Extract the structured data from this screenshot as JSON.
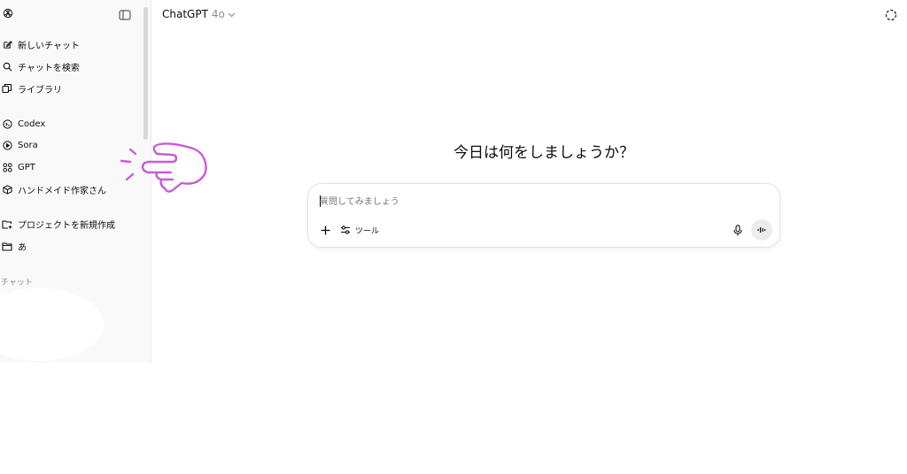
{
  "colors": {
    "sidebar_bg": "#f9f9f9",
    "accent_annotation": "#c85bd8",
    "muted_text": "#8f8f8f"
  },
  "sidebar": {
    "items": [
      {
        "label": "新しいチャット",
        "icon": "new-chat-icon"
      },
      {
        "label": "チャットを検索",
        "icon": "search-icon"
      },
      {
        "label": "ライブラリ",
        "icon": "library-icon"
      },
      {
        "label": "Codex",
        "icon": "codex-icon"
      },
      {
        "label": "Sora",
        "icon": "sora-play-icon"
      },
      {
        "label": "GPT",
        "icon": "gpt-grid-icon"
      },
      {
        "label": "ハンドメイド作家さん",
        "icon": "gpt-cube-icon"
      },
      {
        "label": "プロジェクトを新規作成",
        "icon": "new-project-folder-icon"
      },
      {
        "label": "あ",
        "icon": "folder-icon"
      }
    ],
    "chats_section_label": "チャット"
  },
  "header": {
    "model_name": "ChatGPT",
    "model_version": "4o"
  },
  "main": {
    "greeting": "今日は何をしましょうか？",
    "composer": {
      "placeholder": "質問してみましょう",
      "tools_label": "ツール"
    }
  }
}
